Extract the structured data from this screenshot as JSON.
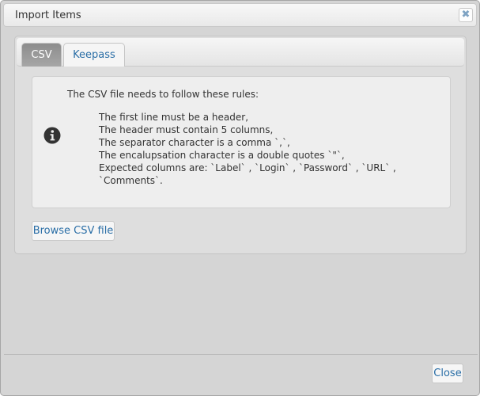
{
  "dialog": {
    "title": "Import Items",
    "close_icon": "close-x-icon"
  },
  "tabs": [
    {
      "label": "CSV",
      "active": true
    },
    {
      "label": "Keepass",
      "active": false
    }
  ],
  "csv": {
    "info_heading": "The CSV file needs to follow these rules:",
    "info_icon": "info-circle-icon",
    "rules": [
      "The first line must be a header,",
      "The header must contain 5 columns,",
      "The separator character is a comma `,`,",
      "The encalupsation character is a double quotes `\"`,",
      "Expected columns are: `Label` , `Login` , `Password` , `URL` ,",
      "`Comments`."
    ],
    "browse_label": "Browse CSV file"
  },
  "footer": {
    "close_label": "Close"
  },
  "colors": {
    "link_blue": "#2a6ea6",
    "active_tab": "#9a9a9a",
    "background": "#d5d5d5"
  }
}
